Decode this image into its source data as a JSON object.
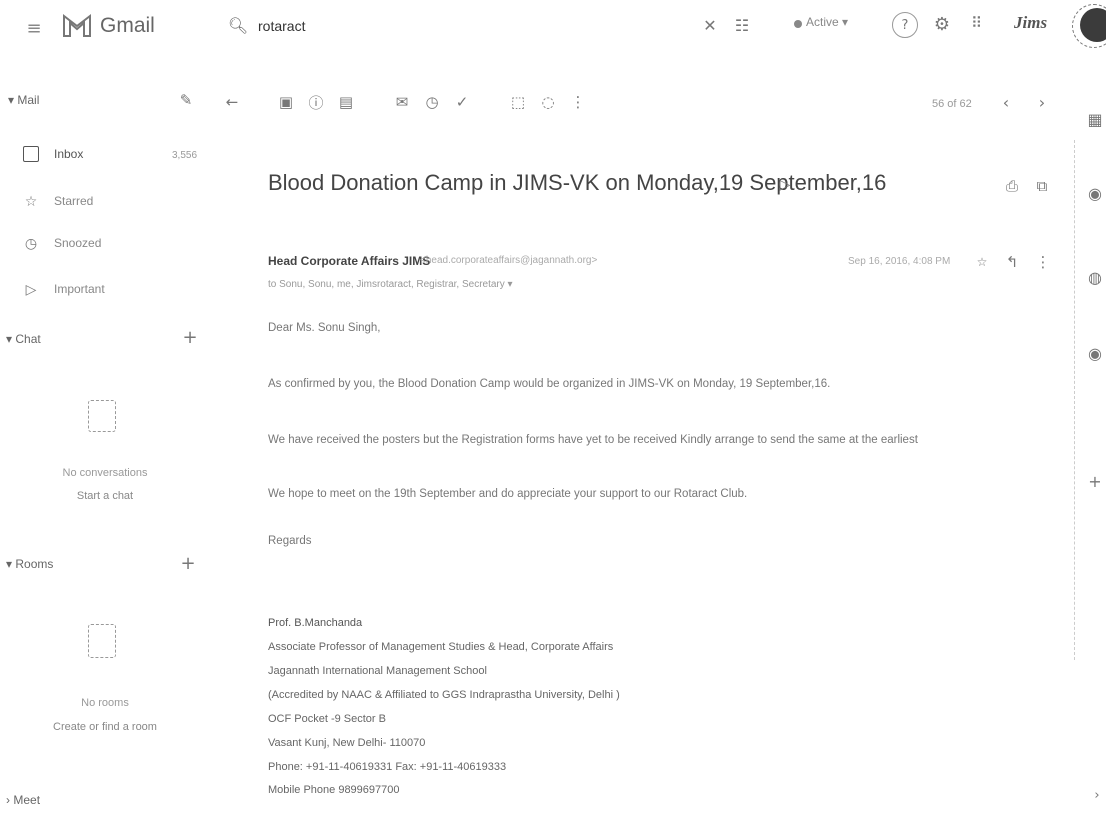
{
  "header": {
    "app_name": "Gmail",
    "search_value": "rotaract",
    "status": "Active",
    "org_logo_text": "Jims"
  },
  "icons": {
    "menu": "≡",
    "search": "🔍︎",
    "clear": "✕",
    "filter": "☷",
    "help": "?",
    "settings": "⚙",
    "apps": "⠿",
    "compose": "✎",
    "star": "☆",
    "snooze": "◷",
    "important": "▷",
    "add": "+",
    "back": "←",
    "archive": "▣",
    "report": "ⓘ",
    "delete": "▤",
    "mark_unread": "✉",
    "snooze_tb": "◷",
    "task": "✓",
    "move": "⬚",
    "label": "◌",
    "more": "⋮",
    "prev": "‹",
    "next": "›",
    "label_tag": "▷",
    "print": "⎙",
    "new_window": "⧉",
    "reply": "↰",
    "calendar": "▦",
    "keep": "◉",
    "tasks": "◍",
    "plus": "+",
    "chevron": "›"
  },
  "sidebar": {
    "mail_label": "Mail",
    "items": [
      {
        "label": "Inbox",
        "count": "3,556"
      },
      {
        "label": "Starred"
      },
      {
        "label": "Snoozed"
      },
      {
        "label": "Important"
      }
    ],
    "chat": {
      "label": "Chat",
      "empty": "No conversations",
      "action": "Start a chat"
    },
    "rooms": {
      "label": "Rooms",
      "empty": "No rooms",
      "action": "Create or find a room"
    },
    "meet": {
      "label": "Meet"
    }
  },
  "toolbar": {
    "pager": "56 of 62"
  },
  "message": {
    "subject": "Blood Donation Camp in JIMS-VK on Monday,19 September,16",
    "sender_name": "Head Corporate Affairs JIMS",
    "sender_email": "<head.corporateaffairs@jagannath.org>",
    "date": "Sep 16, 2016, 4:08 PM",
    "recipients": "to Sonu, Sonu, me, Jimsrotaract, Registrar, Secretary",
    "greeting": "Dear Ms. Sonu Singh,",
    "body": [
      "As confirmed by you, the Blood Donation Camp would be organized in JIMS-VK on Monday, 19 September,16.",
      "We have received the posters but the Registration forms have yet to be received Kindly arrange to send the same at the earliest",
      "We hope to meet on the 19th September and do appreciate your support to our Rotaract Club."
    ],
    "regards": "Regards",
    "signature": [
      "Prof. B.Manchanda",
      "Associate Professor of Management Studies & Head, Corporate Affairs",
      "Jagannath International Management School",
      "(Accredited by NAAC & Affiliated to GGS Indraprastha University, Delhi )",
      "OCF Pocket -9 Sector B",
      "Vasant Kunj, New Delhi- 110070",
      "Phone: +91-11-40619331 Fax: +91-11-40619333",
      "Mobile Phone 9899697700"
    ]
  }
}
